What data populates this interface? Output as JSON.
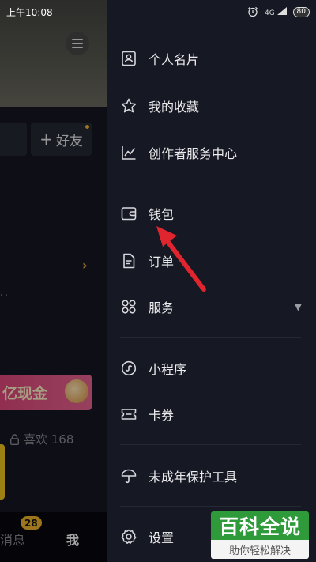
{
  "status_bar": {
    "time": "上午10:08",
    "network": "4G",
    "battery": "80"
  },
  "background_page": {
    "add_friend_label": "好友",
    "banner_text": "亿现金",
    "likes_text": "喜欢 168",
    "tabs": {
      "messages_label": "消息",
      "messages_badge": "28",
      "me_label": "我"
    }
  },
  "drawer": {
    "items": [
      {
        "label": "个人名片",
        "icon": "id-card-icon"
      },
      {
        "label": "我的收藏",
        "icon": "star-icon"
      },
      {
        "label": "创作者服务中心",
        "icon": "line-chart-icon"
      },
      {
        "label": "钱包",
        "icon": "wallet-icon"
      },
      {
        "label": "订单",
        "icon": "document-icon"
      },
      {
        "label": "服务",
        "icon": "grid-icon"
      },
      {
        "label": "小程序",
        "icon": "mini-program-icon"
      },
      {
        "label": "卡券",
        "icon": "ticket-icon"
      },
      {
        "label": "未成年保护工具",
        "icon": "umbrella-icon"
      },
      {
        "label": "设置",
        "icon": "gear-icon"
      }
    ]
  },
  "watermark": {
    "title": "百科全说",
    "subtitle": "助你轻松解决"
  },
  "colors": {
    "drawer_bg": "#161823",
    "accent_yellow": "#f0b42b",
    "annotation_red": "#e0252f",
    "watermark_green": "#2e9a3a"
  }
}
